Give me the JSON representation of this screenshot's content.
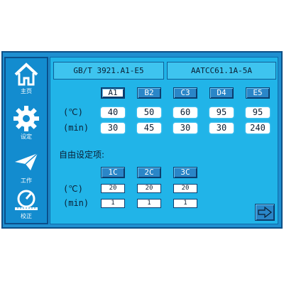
{
  "sidebar": {
    "items": [
      {
        "label": "主页",
        "icon": "home-icon"
      },
      {
        "label": "设定",
        "icon": "gear-icon"
      },
      {
        "label": "工作",
        "icon": "paper-plane-icon"
      },
      {
        "label": "校正",
        "icon": "gauge-icon"
      }
    ]
  },
  "tabs": [
    {
      "label": "GB/T 3921.A1-E5"
    },
    {
      "label": "AATCC61.1A-5A"
    }
  ],
  "standard_table": {
    "columns": [
      "A1",
      "B2",
      "C3",
      "D4",
      "E5"
    ],
    "selected": "A1",
    "row_labels": {
      "temp": "(℃)",
      "time": "(min)"
    },
    "temps": [
      "40",
      "50",
      "60",
      "95",
      "95"
    ],
    "times": [
      "30",
      "45",
      "30",
      "30",
      "240"
    ]
  },
  "free_settings": {
    "title": "自由设定项:",
    "columns": [
      "1C",
      "2C",
      "3C"
    ],
    "row_labels": {
      "temp": "(℃)",
      "time": "(min)"
    },
    "temps": [
      "20",
      "20",
      "20"
    ],
    "times": [
      "1",
      "1",
      "1"
    ]
  },
  "colors": {
    "panel": "#21b4e8",
    "sidebar": "#138ccf",
    "button": "#2a86c8"
  }
}
